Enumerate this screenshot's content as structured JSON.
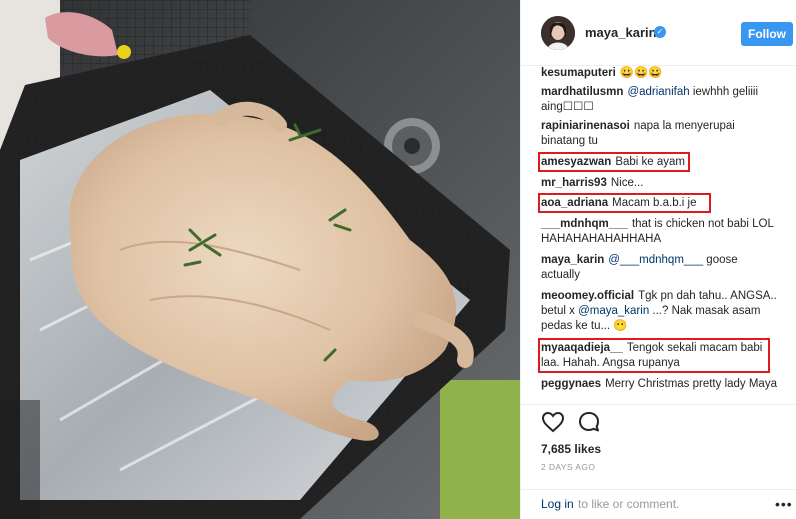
{
  "post": {
    "username": "maya_karin",
    "follow_label": "Follow",
    "likes": "7,685 likes",
    "time_ago": "2 DAYS AGO",
    "login_link": "Log in",
    "login_rest": "to like or comment.",
    "more_label": "•••"
  },
  "comments": [
    {
      "user": "kesumaputeri",
      "text": "😀😀😀",
      "highlighted": false
    },
    {
      "user": "mardhatilusmn",
      "mention": "@adrianifah",
      "text": "iewhhh geliiii aing☐☐☐",
      "highlighted": false
    },
    {
      "user": "rapiniarinenasoi",
      "text": "napa la menyerupai binatang tu",
      "highlighted": false
    },
    {
      "user": "amesyazwan",
      "text": "Babi ke ayam",
      "highlighted": true
    },
    {
      "user": "mr_harris93",
      "text": "Nice...",
      "highlighted": false
    },
    {
      "user": "aoa_adriana",
      "text": "Macam b.a.b.i je",
      "highlighted": true
    },
    {
      "user": "___mdnhqm___",
      "text": "that is chicken not babi LOL HAHAHAHAHAHHAHA",
      "highlighted": false
    },
    {
      "user": "maya_karin",
      "mention": "@___mdnhqm___",
      "text": "goose actually",
      "highlighted": false
    },
    {
      "user": "meoomey.official",
      "text_a": "Tgk pn dah tahu.. ANGSA.. betul x",
      "mention": "@maya_karin",
      "text_b": "...? Nak masak asam pedas ke tu... 😶",
      "highlighted": false
    },
    {
      "user": "myaaqadieja__",
      "text": "Tengok sekali macam babi laa. Hahah. Angsa rupanya",
      "highlighted": true
    },
    {
      "user": "peggynaes",
      "text": "Merry Christmas pretty lady Maya",
      "highlighted": false
    }
  ],
  "colors": {
    "follow_bg": "#3897f0",
    "highlight_border": "#e0191c",
    "link": "#003569"
  },
  "icons": [
    "verified-badge-icon",
    "heart-icon",
    "comment-bubble-icon",
    "more-options-icon"
  ]
}
